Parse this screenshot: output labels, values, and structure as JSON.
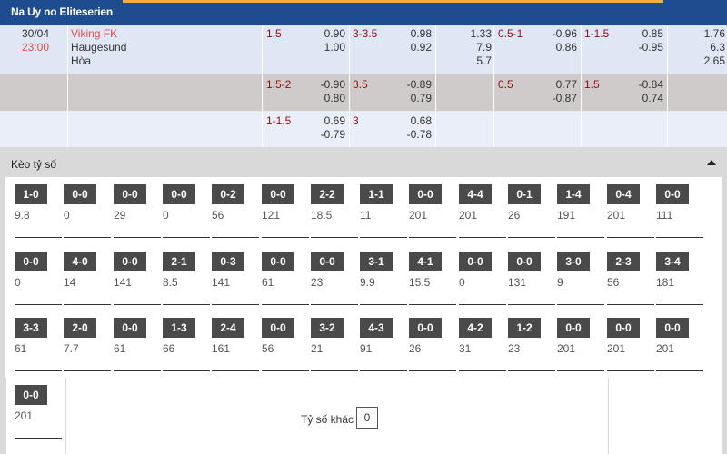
{
  "league": {
    "title": "Na Uy no Eliteserien"
  },
  "match": {
    "date": "30/04",
    "time": "23:00",
    "home": "Viking FK",
    "away": "Haugesund",
    "draw": "Hòa"
  },
  "odds_rows": [
    {
      "ah_line": "1.5",
      "ah_home": "0.90",
      "ah_away": "1.00",
      "ou_line": "3-3.5",
      "ou_over": "0.98",
      "ou_under": "0.92",
      "x12_1": "1.33",
      "x12_2": "7.9",
      "x12_x": "5.7",
      "h1_ah_line": "0.5-1",
      "h1_ah_home": "-0.96",
      "h1_ah_away": "0.86",
      "h1_ou_line": "1-1.5",
      "h1_ou_over": "0.85",
      "h1_ou_under": "-0.95",
      "h1_x12_1": "1.76",
      "h1_x12_2": "6.3",
      "h1_x12_x": "2.65"
    },
    {
      "ah_line": "1.5-2",
      "ah_home": "-0.90",
      "ah_away": "0.80",
      "ou_line": "3.5",
      "ou_over": "-0.89",
      "ou_under": "0.79",
      "h1_ah_line": "0.5",
      "h1_ah_home": "0.77",
      "h1_ah_away": "-0.87",
      "h1_ou_line": "1.5",
      "h1_ou_over": "-0.84",
      "h1_ou_under": "0.74"
    },
    {
      "ah_line": "1-1.5",
      "ah_home": "0.69",
      "ah_away": "-0.79",
      "ou_line": "3",
      "ou_over": "0.68",
      "ou_under": "-0.78"
    }
  ],
  "correct_score": {
    "title": "Kèo tỷ số",
    "rows": [
      [
        [
          "1-0",
          "9.8"
        ],
        [
          "0-0",
          "0"
        ],
        [
          "0-0",
          "29"
        ],
        [
          "0-0",
          "0"
        ],
        [
          "0-2",
          "56"
        ],
        [
          "0-0",
          "121"
        ],
        [
          "2-2",
          "18.5"
        ],
        [
          "1-1",
          "11"
        ],
        [
          "0-0",
          "201"
        ],
        [
          "4-4",
          "201"
        ],
        [
          "0-1",
          "26"
        ],
        [
          "1-4",
          "191"
        ],
        [
          "0-4",
          "201"
        ],
        [
          "0-0",
          "111"
        ]
      ],
      [
        [
          "0-0",
          "0"
        ],
        [
          "4-0",
          "14"
        ],
        [
          "0-0",
          "141"
        ],
        [
          "2-1",
          "8.5"
        ],
        [
          "0-3",
          "141"
        ],
        [
          "0-0",
          "61"
        ],
        [
          "0-0",
          "23"
        ],
        [
          "3-1",
          "9.9"
        ],
        [
          "4-1",
          "15.5"
        ],
        [
          "0-0",
          "0"
        ],
        [
          "0-0",
          "131"
        ],
        [
          "3-0",
          "9"
        ],
        [
          "2-3",
          "56"
        ],
        [
          "3-4",
          "181"
        ]
      ],
      [
        [
          "3-3",
          "61"
        ],
        [
          "2-0",
          "7.7"
        ],
        [
          "0-0",
          "61"
        ],
        [
          "1-3",
          "66"
        ],
        [
          "2-4",
          "161"
        ],
        [
          "0-0",
          "56"
        ],
        [
          "3-2",
          "21"
        ],
        [
          "4-3",
          "91"
        ],
        [
          "0-0",
          "26"
        ],
        [
          "4-2",
          "31"
        ],
        [
          "1-2",
          "23"
        ],
        [
          "0-0",
          "201"
        ],
        [
          "0-0",
          "201"
        ],
        [
          "0-0",
          "201"
        ]
      ],
      [
        [
          "0-0",
          "201"
        ]
      ]
    ],
    "other_label": "Tỷ số khác",
    "other_value": "0"
  }
}
